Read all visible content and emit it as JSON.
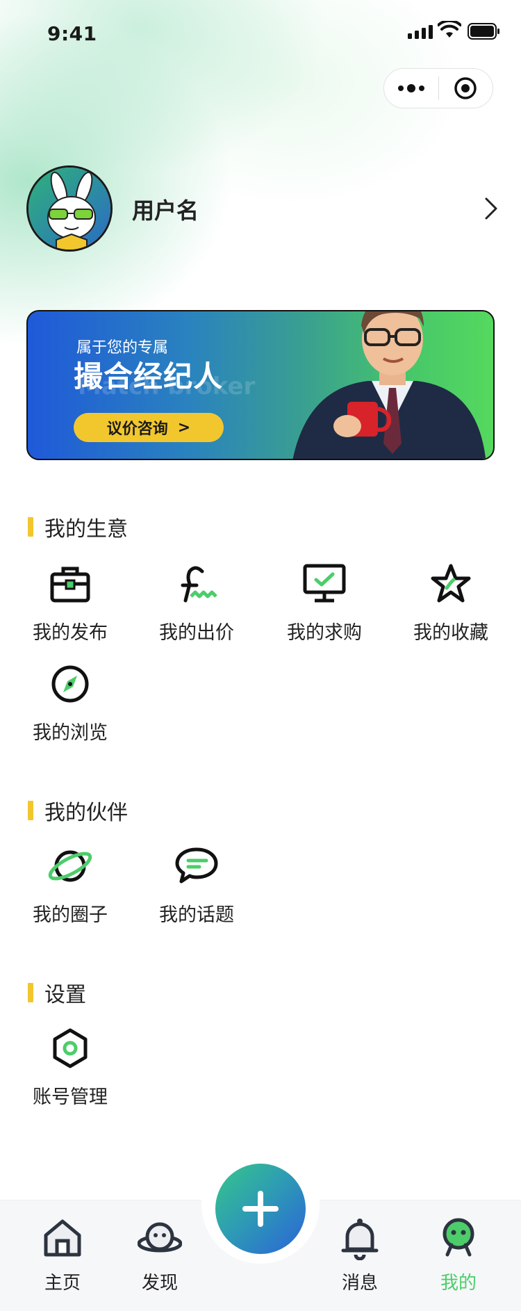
{
  "status_bar": {
    "time": "9:41"
  },
  "capsule": {
    "more_icon": "more-dots-icon",
    "close_icon": "target-icon"
  },
  "profile": {
    "username": "用户名"
  },
  "banner": {
    "subtitle": "属于您的专属",
    "title": "撮合经纪人",
    "ghost_text": "Match broker",
    "button_label": "议价咨询",
    "button_arrow": ">"
  },
  "sections": {
    "business": {
      "title": "我的生意",
      "items": [
        {
          "label": "我的发布",
          "icon": "briefcase-icon"
        },
        {
          "label": "我的出价",
          "icon": "pound-wave-icon"
        },
        {
          "label": "我的求购",
          "icon": "monitor-check-icon"
        },
        {
          "label": "我的收藏",
          "icon": "star-icon"
        },
        {
          "label": "我的浏览",
          "icon": "compass-icon"
        }
      ]
    },
    "partners": {
      "title": "我的伙伴",
      "items": [
        {
          "label": "我的圈子",
          "icon": "planet-icon"
        },
        {
          "label": "我的话题",
          "icon": "chat-bubble-icon"
        }
      ]
    },
    "settings": {
      "title": "设置",
      "items": [
        {
          "label": "账号管理",
          "icon": "hexagon-settings-icon"
        }
      ]
    }
  },
  "tabbar": {
    "items": [
      {
        "label": "主页",
        "icon": "home-icon"
      },
      {
        "label": "发现",
        "icon": "discover-planet-icon"
      },
      {
        "label": "消息",
        "icon": "bell-icon"
      },
      {
        "label": "我的",
        "icon": "profile-robot-icon",
        "active": true
      }
    ],
    "fab_icon": "plus-icon"
  },
  "colors": {
    "accent_green": "#4ccd6a",
    "accent_yellow": "#f2c72e",
    "banner_blue": "#1f59d9"
  }
}
